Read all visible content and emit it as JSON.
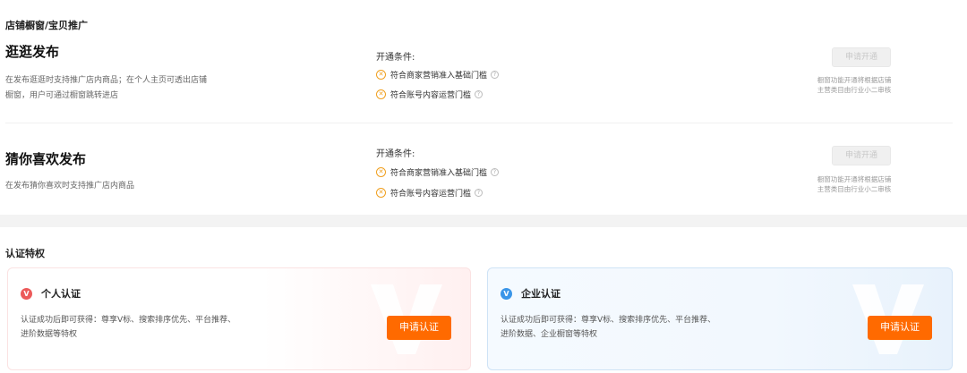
{
  "promo_section": {
    "title": "店铺橱窗/宝贝推广",
    "features": [
      {
        "title": "逛逛发布",
        "desc_line1": "在发布逛逛时支持推广店内商品；在个人主页可透出店铺",
        "desc_line2": "橱窗，用户可通过橱窗跳转进店",
        "cond_title": "开通条件:",
        "conditions": [
          "符合商家营销准入基础门槛",
          "符合账号内容运营门槛"
        ],
        "button": "申请开通",
        "note_line1": "橱窗功能开通将根据店铺",
        "note_line2": "主营类目由行业小二审核"
      },
      {
        "title": "猜你喜欢发布",
        "desc_line1": "在发布猜你喜欢时支持推广店内商品",
        "cond_title": "开通条件:",
        "conditions": [
          "符合商家营销准入基础门槛",
          "符合账号内容运营门槛"
        ],
        "button": "申请开通",
        "note_line1": "橱窗功能开通将根据店铺",
        "note_line2": "主营类目由行业小二审核"
      }
    ]
  },
  "cert_section": {
    "title": "认证特权",
    "cards": [
      {
        "badge": "V",
        "name": "个人认证",
        "desc_line1": "认证成功后即可获得：尊享V标、搜索排序优先、平台推荐、",
        "desc_line2": "进阶数据等特权",
        "button": "申请认证",
        "badge_color": "#ec5a5a"
      },
      {
        "badge": "V",
        "name": "企业认证",
        "desc_line1": "认证成功后即可获得：尊享V标、搜索排序优先、平台推荐、",
        "desc_line2": "进阶数据、企业橱窗等特权",
        "button": "申请认证",
        "badge_color": "#3a95e8"
      }
    ]
  },
  "icons": {
    "condition_status": "x-circle-icon",
    "help": "question-circle-icon",
    "watermark": "v-logo-watermark-icon"
  },
  "colors": {
    "accent_button": "#ff6a00",
    "condition_icon": "#f0a020",
    "disabled_button_bg": "#f0f0f0"
  }
}
